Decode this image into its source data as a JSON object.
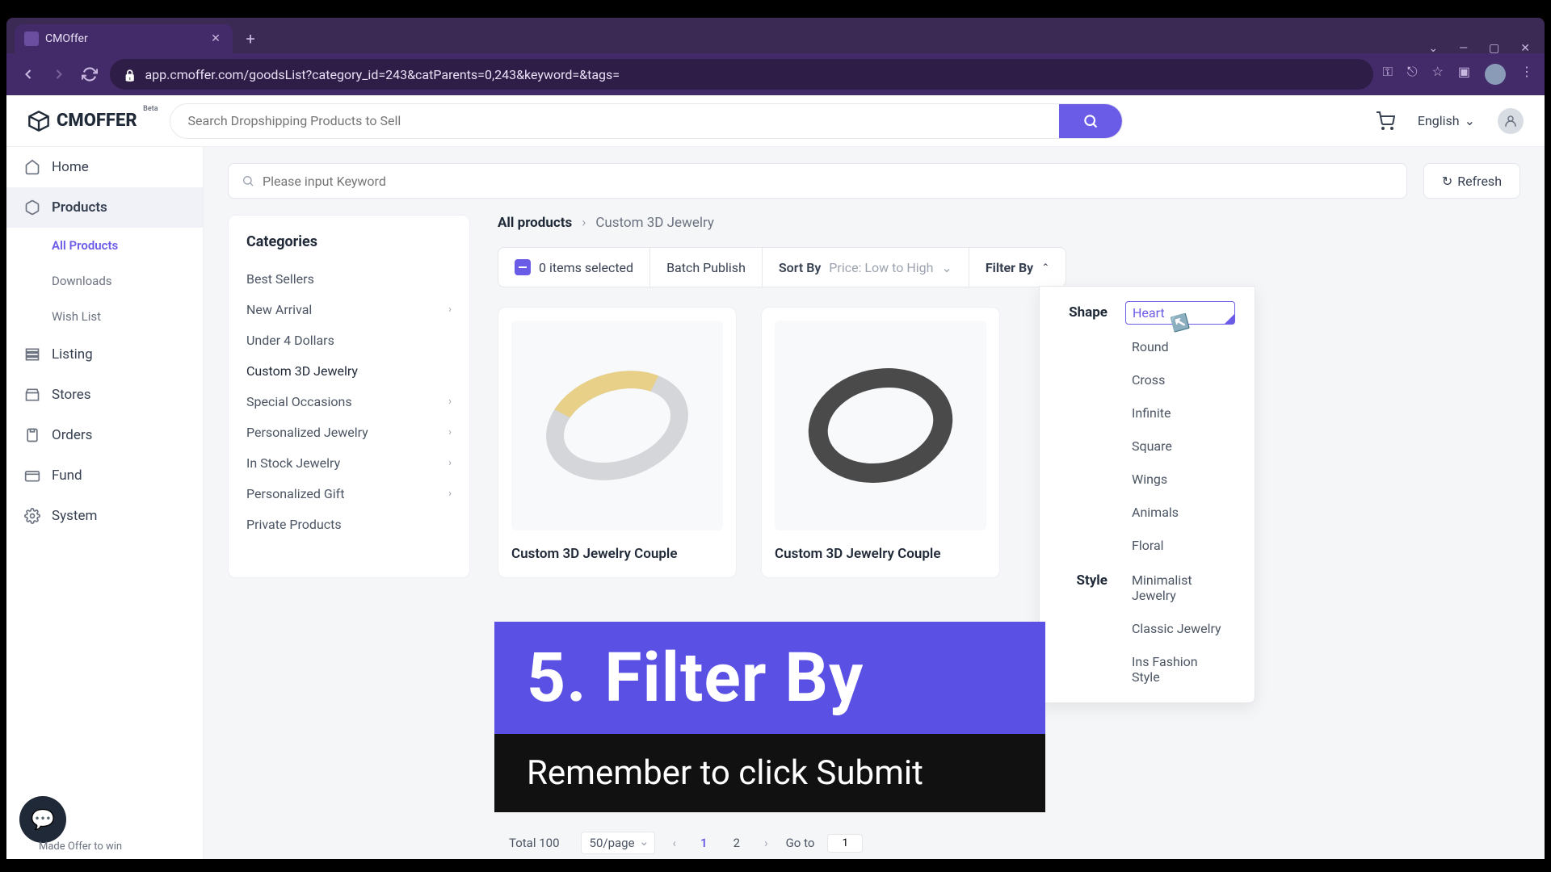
{
  "browser": {
    "tab_title": "CMOffer",
    "url": "app.cmoffer.com/goodsList?category_id=243&catParents=0,243&keyword=&tags="
  },
  "header": {
    "logo_text": "CMOFFER",
    "logo_beta": "Beta",
    "search_placeholder": "Search Dropshipping Products to Sell",
    "language": "English"
  },
  "sidebar": {
    "items": [
      {
        "label": "Home"
      },
      {
        "label": "Products"
      },
      {
        "label": "Listing"
      },
      {
        "label": "Stores"
      },
      {
        "label": "Orders"
      },
      {
        "label": "Fund"
      },
      {
        "label": "System"
      }
    ],
    "sub_items": [
      {
        "label": "All Products"
      },
      {
        "label": "Downloads"
      },
      {
        "label": "Wish List"
      }
    ],
    "promo": "Made Offer to win"
  },
  "keyword_placeholder": "Please input Keyword",
  "refresh_label": "Refresh",
  "categories": {
    "title": "Categories",
    "items": [
      {
        "label": "Best Sellers",
        "expandable": false
      },
      {
        "label": "New Arrival",
        "expandable": true
      },
      {
        "label": "Under 4 Dollars",
        "expandable": false
      },
      {
        "label": "Custom 3D Jewelry",
        "expandable": false
      },
      {
        "label": "Special Occasions",
        "expandable": true
      },
      {
        "label": "Personalized Jewelry",
        "expandable": true
      },
      {
        "label": "In Stock Jewelry",
        "expandable": true
      },
      {
        "label": "Personalized Gift",
        "expandable": true
      },
      {
        "label": "Private Products",
        "expandable": false
      }
    ]
  },
  "breadcrumb": {
    "root": "All products",
    "leaf": "Custom 3D Jewelry"
  },
  "toolbar": {
    "selected_text": "0 items selected",
    "batch_publish": "Batch Publish",
    "sort_label": "Sort By",
    "sort_value": "Price: Low to High",
    "filter_label": "Filter By"
  },
  "products": [
    {
      "title": "Custom 3D Jewelry Couple"
    },
    {
      "title": "Custom 3D Jewelry Couple"
    }
  ],
  "filter_panel": {
    "groups": [
      {
        "label": "Shape",
        "options": [
          "Heart",
          "Round",
          "Cross",
          "Infinite",
          "Square",
          "Wings",
          "Animals",
          "Floral"
        ],
        "selected": "Heart"
      },
      {
        "label": "Style",
        "options": [
          "Minimalist Jewelry",
          "Classic Jewelry",
          "Ins Fashion Style"
        ],
        "selected": null
      }
    ]
  },
  "overlay": {
    "blue": "5. Filter By",
    "dark": "Remember to click Submit"
  },
  "pagination": {
    "total": "Total 100",
    "per_page": "50/page",
    "current": "1",
    "pages": [
      "1",
      "2"
    ],
    "goto_label": "Go to",
    "goto_value": "1"
  }
}
